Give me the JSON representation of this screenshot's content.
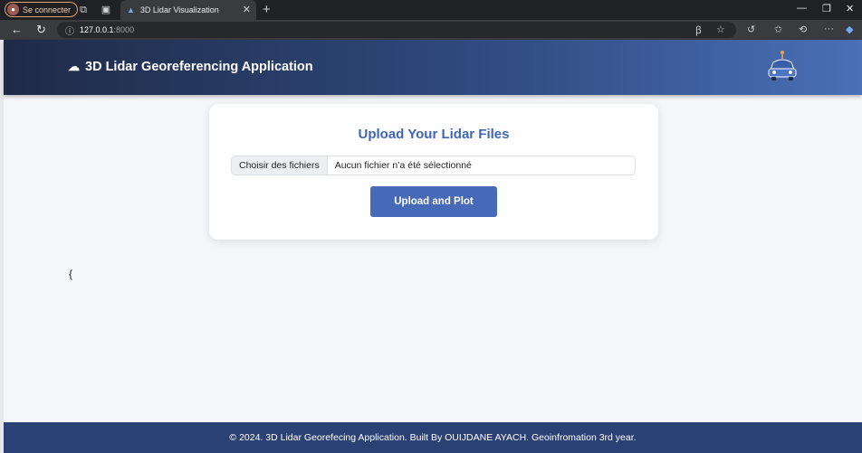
{
  "browser": {
    "profile_label": "Se connecter",
    "tab_title": "3D Lidar Visualization",
    "url_host": "127.0.0.1",
    "url_port": ":8000"
  },
  "header": {
    "title": "3D Lidar Georeferencing Application"
  },
  "upload": {
    "title": "Upload Your Lidar Files",
    "choose_label": "Choisir des fichiers",
    "file_status": "Aucun fichier n’a été sélectionné",
    "submit_label": "Upload and Plot"
  },
  "output": {
    "text": "{"
  },
  "footer": {
    "text": "© 2024. 3D Lidar Georefecing Application. Built By OUIJDANE AYACH. Geoinfromation 3rd year."
  },
  "colors": {
    "header_gradient_start": "#1f2a47",
    "header_gradient_end": "#4a6fb7",
    "accent": "#3f66b5",
    "button": "#4669b8",
    "footer": "#2b4173"
  },
  "icons": {
    "header": "cloud-icon",
    "logo": "robot-car-icon"
  }
}
